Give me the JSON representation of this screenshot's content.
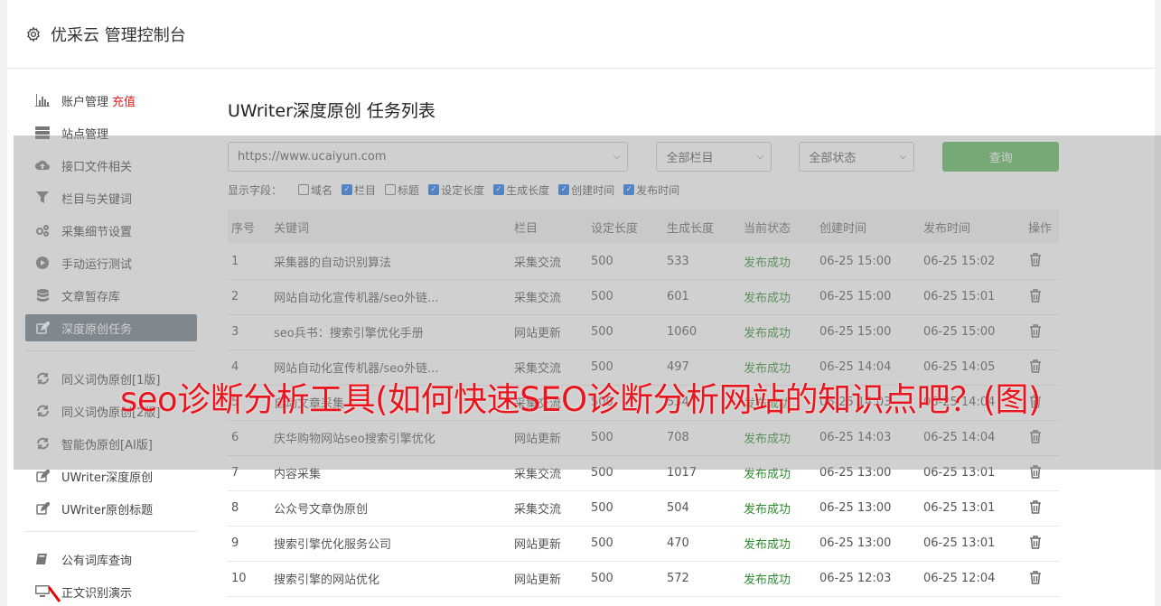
{
  "app": {
    "title": "优采云 管理控制台",
    "gear_icon": "gear-icon"
  },
  "sidebar": {
    "group1": [
      {
        "label": "账户管理",
        "badge": "充值",
        "icon": "bar-chart-icon"
      },
      {
        "label": "站点管理",
        "icon": "server-icon"
      },
      {
        "label": "接口文件相关",
        "icon": "cloud-upload-icon"
      },
      {
        "label": "栏目与关键词",
        "icon": "filter-icon"
      },
      {
        "label": "采集细节设置",
        "icon": "cogs-icon"
      },
      {
        "label": "手动运行测试",
        "icon": "play-circle-icon"
      },
      {
        "label": "文章暂存库",
        "icon": "database-icon"
      },
      {
        "label": "深度原创任务",
        "icon": "edit-icon",
        "active": true
      }
    ],
    "group2": [
      {
        "label": "同义词伪原创[1版]",
        "icon": "refresh-icon"
      },
      {
        "label": "同义词伪原创[2版]",
        "icon": "refresh-icon"
      },
      {
        "label": "智能伪原创[AI版]",
        "icon": "refresh-icon"
      },
      {
        "label": "UWriter深度原创",
        "icon": "edit-icon"
      },
      {
        "label": "UWriter原创标题",
        "icon": "edit-icon"
      }
    ],
    "group3": [
      {
        "label": "公有词库查询",
        "icon": "book-icon"
      },
      {
        "label": "正文识别演示",
        "icon": "monitor-icon"
      }
    ]
  },
  "main": {
    "title": "UWriter深度原创 任务列表",
    "filters": {
      "site": "https://www.ucaiyun.com",
      "column": "全部栏目",
      "status": "全部状态",
      "query_label": "查询"
    },
    "fields": {
      "label": "显示字段：",
      "options": [
        {
          "label": "域名",
          "checked": false
        },
        {
          "label": "栏目",
          "checked": true
        },
        {
          "label": "标题",
          "checked": false
        },
        {
          "label": "设定长度",
          "checked": true
        },
        {
          "label": "生成长度",
          "checked": true
        },
        {
          "label": "创建时间",
          "checked": true
        },
        {
          "label": "发布时间",
          "checked": true
        }
      ]
    },
    "table": {
      "headers": [
        "序号",
        "关键词",
        "栏目",
        "设定长度",
        "生成长度",
        "当前状态",
        "创建时间",
        "发布时间",
        "操作"
      ],
      "rows": [
        [
          "1",
          "采集器的自动识别算法",
          "采集交流",
          "500",
          "533",
          "发布成功",
          "06-25 15:00",
          "06-25 15:02"
        ],
        [
          "2",
          "网站自动化宣传机器/seo外链...",
          "采集交流",
          "500",
          "601",
          "发布成功",
          "06-25 15:00",
          "06-25 15:01"
        ],
        [
          "3",
          "seo兵书：搜索引擎优化手册",
          "网站更新",
          "500",
          "1060",
          "发布成功",
          "06-25 15:00",
          "06-25 15:00"
        ],
        [
          "4",
          "网站自动化宣传机器/seo外链...",
          "采集交流",
          "500",
          "497",
          "发布成功",
          "06-25 14:04",
          "06-25 14:05"
        ],
        [
          "5",
          "自动文章采集",
          "采集交流",
          "500",
          "534",
          "发布成功",
          "06-25 14:03",
          "06-25 14:04"
        ],
        [
          "6",
          "庆华购物网站seo搜索引擎优化",
          "网站更新",
          "500",
          "708",
          "发布成功",
          "06-25 14:03",
          "06-25 14:04"
        ],
        [
          "7",
          "内容采集",
          "采集交流",
          "500",
          "1017",
          "发布成功",
          "06-25 13:00",
          "06-25 13:01"
        ],
        [
          "8",
          "公众号文章伪原创",
          "采集交流",
          "500",
          "504",
          "发布成功",
          "06-25 13:00",
          "06-25 13:01"
        ],
        [
          "9",
          "搜索引擎优化服务公司",
          "网站更新",
          "500",
          "470",
          "发布成功",
          "06-25 13:00",
          "06-25 13:01"
        ],
        [
          "10",
          "搜索引擎的网站优化",
          "网站更新",
          "500",
          "572",
          "发布成功",
          "06-25 12:03",
          "06-25 12:04"
        ]
      ]
    }
  },
  "banner": {
    "text": "seo诊断分析工具(如何快速SEO诊断分析网站的知识点吧？(图)"
  },
  "colors": {
    "active_bg": "#6c7a89",
    "success": "#2e8b2e",
    "query_btn": "#5cb85c",
    "banner": "#e8171f"
  }
}
